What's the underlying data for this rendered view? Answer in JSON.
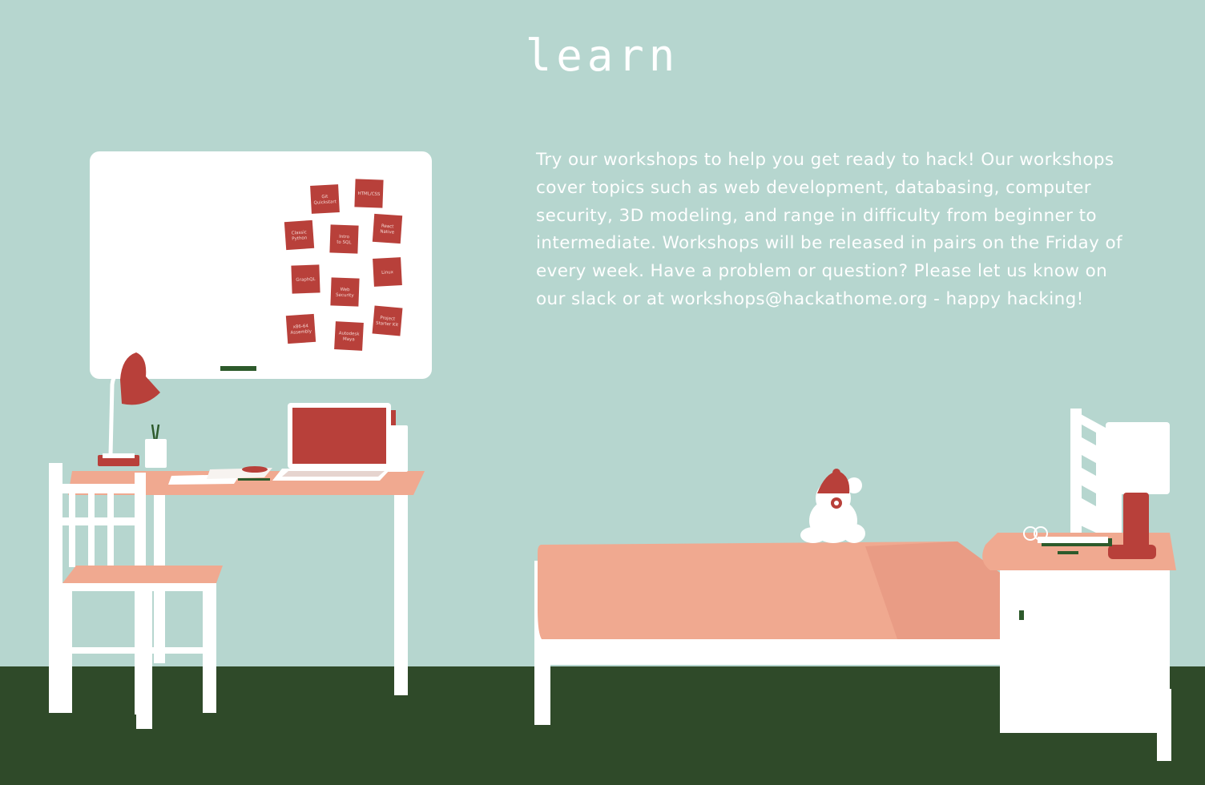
{
  "page": {
    "title": "learn",
    "intro": "Try our workshops to help you get ready to hack! Our workshops cover topics such as web development, databasing, computer security, 3D modeling, and range in difficulty from beginner to intermediate. Workshops will be released in pairs on the Friday of every week. Have a problem or question? Please let us know on our slack or at workshops@hackathome.org - happy hacking!"
  },
  "whiteboard": {
    "notes": [
      {
        "id": "git",
        "label": [
          "Git",
          "Quickstart"
        ]
      },
      {
        "id": "html",
        "label": [
          "HTML/CSS"
        ]
      },
      {
        "id": "python",
        "label": [
          "Classic",
          "Python"
        ]
      },
      {
        "id": "sql",
        "label": [
          "Intro",
          "to SQL"
        ]
      },
      {
        "id": "react",
        "label": [
          "React",
          "Native"
        ]
      },
      {
        "id": "graphql",
        "label": [
          "GraphQL"
        ]
      },
      {
        "id": "linux",
        "label": [
          "Linux"
        ]
      },
      {
        "id": "web",
        "label": [
          "Web",
          "Security"
        ]
      },
      {
        "id": "x86",
        "label": [
          "x86-64",
          "Assembly"
        ]
      },
      {
        "id": "maya",
        "label": [
          "Autodesk",
          "Maya"
        ]
      },
      {
        "id": "project",
        "label": [
          "Project",
          "Starter Kit"
        ]
      }
    ]
  },
  "colors": {
    "wall": "#b6d6cf",
    "floor": "#2f4a29",
    "accent_red": "#b8403a",
    "salmon": "#f0a990",
    "white": "#ffffff",
    "dark_green": "#2d5a2b"
  }
}
